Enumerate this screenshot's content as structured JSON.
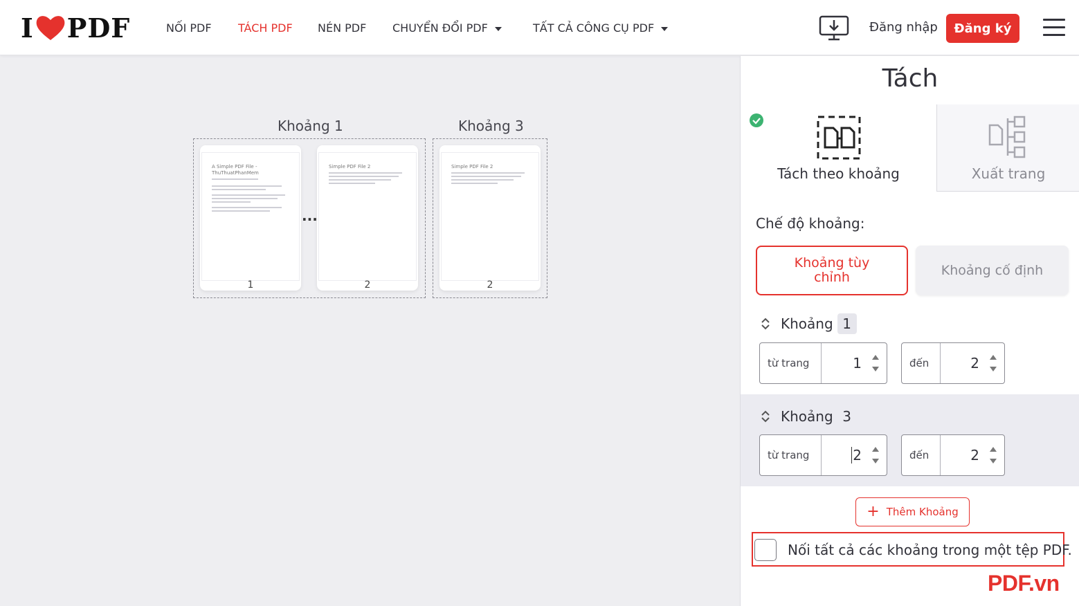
{
  "header": {
    "logo": {
      "left": "I",
      "right": "PDF"
    },
    "nav": [
      {
        "label": "NỐI PDF",
        "active": false,
        "dropdown": false
      },
      {
        "label": "TÁCH PDF",
        "active": true,
        "dropdown": false
      },
      {
        "label": "NÉN PDF",
        "active": false,
        "dropdown": false
      },
      {
        "label": "CHUYỂN ĐỔI PDF",
        "active": false,
        "dropdown": true
      },
      {
        "label": "TẤT CẢ CÔNG CỤ PDF",
        "active": false,
        "dropdown": true
      }
    ],
    "login": "Đăng nhập",
    "signup": "Đăng ký"
  },
  "preview": {
    "ranges": [
      {
        "label": "Khoảng 1",
        "ellipsis": "...",
        "pages": [
          {
            "number": "1",
            "heading": "A Simple PDF File - ThuThuatPhanMem"
          },
          {
            "number": "2",
            "heading": "Simple PDF File 2"
          }
        ]
      },
      {
        "label": "Khoảng 3",
        "pages": [
          {
            "number": "2",
            "heading": "Simple PDF File 2"
          }
        ]
      }
    ]
  },
  "sidebar": {
    "title": "Tách",
    "modes": [
      {
        "label": "Tách theo khoảng",
        "selected": true,
        "icon": "split-range-icon"
      },
      {
        "label": "Xuất trang",
        "selected": false,
        "icon": "extract-pages-icon"
      }
    ],
    "range_mode_label": "Chế độ khoảng:",
    "range_modes": [
      {
        "label": "Khoảng tùy chỉnh",
        "selected": true
      },
      {
        "label": "Khoảng cố định",
        "selected": false
      }
    ],
    "ranges": [
      {
        "label": "Khoảng",
        "index": "1",
        "from_label": "từ trang",
        "from": "1",
        "to_label": "đến",
        "to": "2"
      },
      {
        "label": "Khoảng",
        "index": "3",
        "from_label": "từ trang",
        "from": "2",
        "to_label": "đến",
        "to": "2"
      }
    ],
    "add_range": "Thêm Khoảng",
    "merge_label": "Nối tất cả các khoảng trong một tệp PDF.",
    "merge_checked": false
  },
  "watermark": "PDF.vn",
  "colors": {
    "brand": "#e5322d",
    "success": "#3cb371"
  }
}
